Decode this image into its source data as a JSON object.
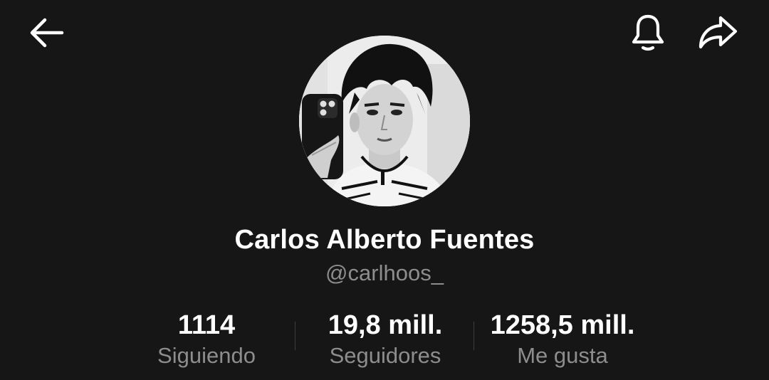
{
  "header": {
    "back_icon": "arrow-left-icon",
    "notification_icon": "bell-icon",
    "share_icon": "share-arrow-icon"
  },
  "profile": {
    "avatar_description": "black-and-white selfie photo",
    "display_name": "Carlos Alberto Fuentes",
    "username": "@carlhoos_"
  },
  "stats": [
    {
      "value": "1114",
      "label": "Siguiendo"
    },
    {
      "value": "19,8 mill.",
      "label": "Seguidores"
    },
    {
      "value": "1258,5 mill.",
      "label": "Me gusta"
    }
  ],
  "colors": {
    "background": "#161616",
    "primary_text": "#ffffff",
    "secondary_text": "#8d8d8d"
  }
}
